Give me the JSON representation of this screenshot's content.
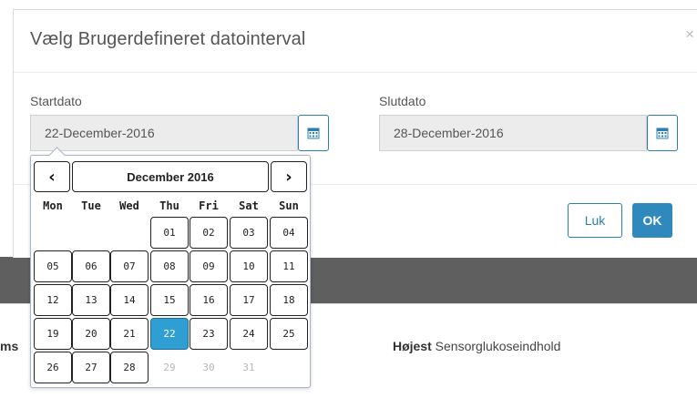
{
  "modal": {
    "title": "Vælg Brugerdefineret datointerval",
    "close_glyph": "×",
    "start_label": "Startdato",
    "start_value": "22-December-2016",
    "end_label": "Slutdato",
    "end_value": "28-December-2016",
    "close_button": "Luk",
    "ok_button": "OK"
  },
  "datepicker": {
    "prev_glyph": "‹",
    "next_glyph": "›",
    "month_label": "December 2016",
    "weekdays": [
      "Mon",
      "Tue",
      "Wed",
      "Thu",
      "Fri",
      "Sat",
      "Sun"
    ],
    "weeks": [
      [
        "",
        "",
        "",
        "01",
        "02",
        "03",
        "04"
      ],
      [
        "05",
        "06",
        "07",
        "08",
        "09",
        "10",
        "11"
      ],
      [
        "12",
        "13",
        "14",
        "15",
        "16",
        "17",
        "18"
      ],
      [
        "19",
        "20",
        "21",
        "22",
        "23",
        "24",
        "25"
      ],
      [
        "26",
        "27",
        "28",
        "29",
        "30",
        "31",
        ""
      ]
    ],
    "selected": "22",
    "disabled": [
      "29",
      "30",
      "31"
    ]
  },
  "background": {
    "left_text": "ms",
    "right_bold": "Højest",
    "right_text": " Sensorglukoseindhold"
  },
  "colors": {
    "accent": "#2f89bd",
    "selected_day": "#2f9fd3",
    "input_bg": "#ececec",
    "backdrop": "#5f5f5f"
  },
  "icons": {
    "calendar": "calendar-icon",
    "close": "close-icon"
  }
}
